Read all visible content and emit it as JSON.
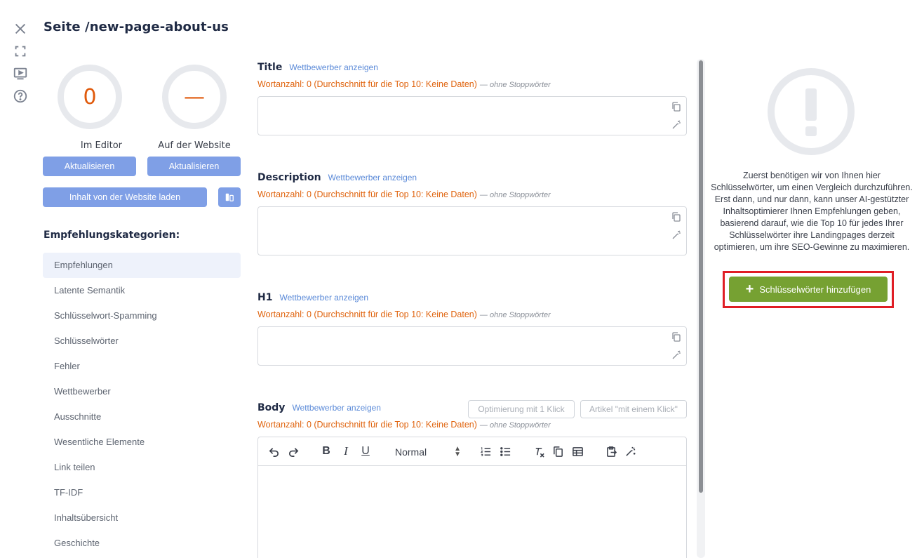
{
  "header": {
    "title": "Seite /new-page-about-us"
  },
  "scores": {
    "editor": {
      "value": "0",
      "caption": "Im Editor",
      "button": "Aktualisieren"
    },
    "website": {
      "value": "—",
      "caption": "Auf der Website",
      "button": "Aktualisieren"
    }
  },
  "load_button": "Inhalt von der Website laden",
  "categories": {
    "title": "Empfehlungskategorien:",
    "items": [
      "Empfehlungen",
      "Latente Semantik",
      "Schlüsselwort-Spamming",
      "Schlüsselwörter",
      "Fehler",
      "Wettbewerber",
      "Ausschnitte",
      "Wesentliche Elemente",
      "Link teilen",
      "TF-IDF",
      "Inhaltsübersicht",
      "Geschichte"
    ]
  },
  "fields": {
    "competitor_link": "Wettbewerber anzeigen",
    "word_count": "Wortanzahl: 0 (Durchschnitt für die Top 10: Keine Daten)",
    "stopwords_note": "— ohne Stoppwörter",
    "title": "Title",
    "description": "Description",
    "h1": "H1",
    "body": "Body"
  },
  "body_buttons": {
    "optimize": "Optimierung mit 1 Klick",
    "article": "Artikel \"mit einem Klick\""
  },
  "editor": {
    "format_value": "Normal"
  },
  "right": {
    "message": "Zuerst benötigen wir von Ihnen hier Schlüsselwörter, um einen Vergleich durchzuführen. Erst dann, und nur dann, kann unser AI-gestützter Inhaltsoptimierer Ihnen Empfehlungen geben, basierend darauf, wie die Top 10 für jedes Ihrer Schlüsselwörter ihre Landingpages derzeit optimieren, um ihre SEO-Gewinne zu maximieren.",
    "add_button": "Schlüsselwörter hinzufügen"
  },
  "colors": {
    "accent_blue": "#7f9fe6",
    "warning_orange": "#e0640f",
    "green": "#76a132",
    "highlight_red": "#e01e25"
  }
}
